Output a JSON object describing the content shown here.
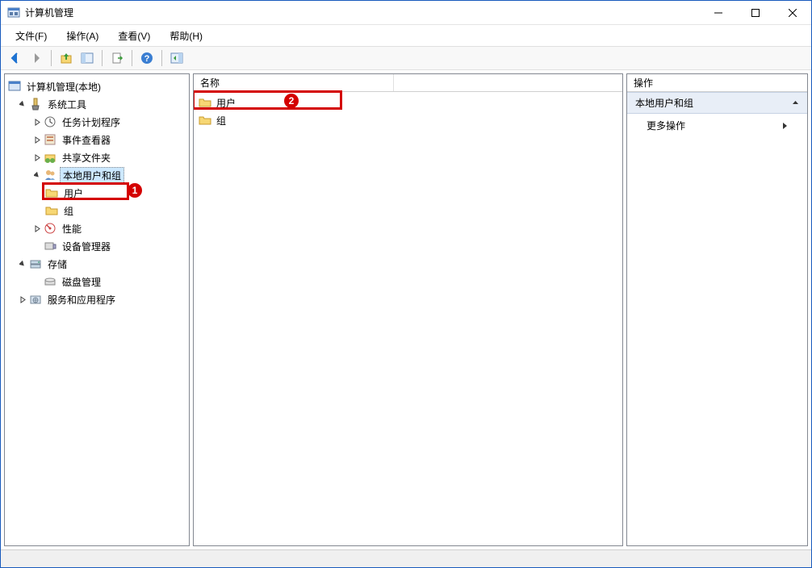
{
  "window": {
    "title": "计算机管理"
  },
  "menubar": {
    "file": "文件(F)",
    "action": "操作(A)",
    "view": "查看(V)",
    "help": "帮助(H)"
  },
  "toolbar_icons": {
    "back": "back-arrow-icon",
    "forward": "forward-arrow-icon",
    "up": "up-folder-icon",
    "show_hide": "panel-icon",
    "refresh": "refresh-icon",
    "export": "export-icon",
    "help": "help-icon",
    "detail": "detail-view-icon"
  },
  "tree": {
    "root": "计算机管理(本地)",
    "system_tools": "系统工具",
    "task_scheduler": "任务计划程序",
    "event_viewer": "事件查看器",
    "shared_folders": "共享文件夹",
    "local_users_groups": "本地用户和组",
    "users": "用户",
    "groups": "组",
    "performance": "性能",
    "device_manager": "设备管理器",
    "storage": "存储",
    "disk_management": "磁盘管理",
    "services_apps": "服务和应用程序"
  },
  "list": {
    "header_name": "名称",
    "row_users": "用户",
    "row_groups": "组"
  },
  "actions": {
    "header": "操作",
    "section": "本地用户和组",
    "more": "更多操作"
  },
  "annotations": {
    "badge1": "1",
    "badge2": "2"
  }
}
